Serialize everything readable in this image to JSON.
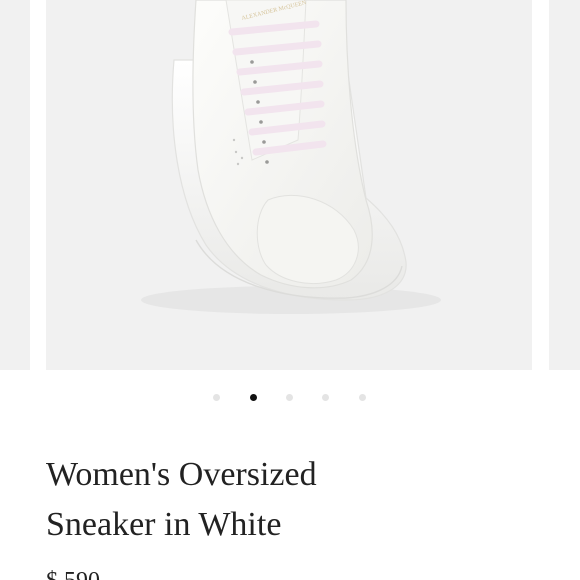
{
  "product": {
    "title_line1": "Women's Oversized",
    "title_line2": "Sneaker in White",
    "price": "$ 590"
  },
  "carousel": {
    "slide_count": 5,
    "active_index": 1,
    "background": "#f1f1f1"
  },
  "colors": {
    "text": "#222222",
    "dot_inactive": "#e4e4e4",
    "dot_active": "#111111",
    "lace_tint": "#f4e6f0",
    "sneaker": "#fbfbf9"
  },
  "image": {
    "subject": "sneaker",
    "brand_mark": "ALEXANDER McQUEEN"
  }
}
